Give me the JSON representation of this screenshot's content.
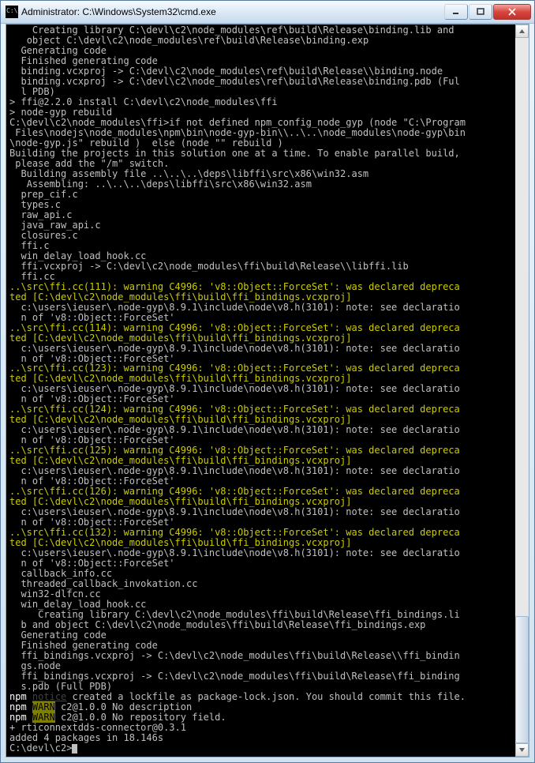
{
  "window": {
    "title": "Administrator: C:\\Windows\\System32\\cmd.exe"
  },
  "terminal": {
    "lines": [
      {
        "cls": "",
        "txt": "    Creating library C:\\devl\\c2\\node_modules\\ref\\build\\Release\\binding.lib and"
      },
      {
        "cls": "",
        "txt": "   object C:\\devl\\c2\\node_modules\\ref\\build\\Release\\binding.exp"
      },
      {
        "cls": "",
        "txt": "  Generating code"
      },
      {
        "cls": "",
        "txt": "  Finished generating code"
      },
      {
        "cls": "",
        "txt": "  binding.vcxproj -> C:\\devl\\c2\\node_modules\\ref\\build\\Release\\\\binding.node"
      },
      {
        "cls": "",
        "txt": "  binding.vcxproj -> C:\\devl\\c2\\node_modules\\ref\\build\\Release\\binding.pdb (Ful"
      },
      {
        "cls": "",
        "txt": "  l PDB)"
      },
      {
        "cls": "",
        "txt": ""
      },
      {
        "cls": "",
        "txt": "> ffi@2.2.0 install C:\\devl\\c2\\node_modules\\ffi"
      },
      {
        "cls": "",
        "txt": "> node-gyp rebuild"
      },
      {
        "cls": "",
        "txt": ""
      },
      {
        "cls": "",
        "txt": ""
      },
      {
        "cls": "",
        "txt": "C:\\devl\\c2\\node_modules\\ffi>if not defined npm_config_node_gyp (node \"C:\\Program"
      },
      {
        "cls": "",
        "txt": " Files\\nodejs\\node_modules\\npm\\bin\\node-gyp-bin\\\\..\\..\\node_modules\\node-gyp\\bin"
      },
      {
        "cls": "",
        "txt": "\\node-gyp.js\" rebuild )  else (node \"\" rebuild )"
      },
      {
        "cls": "",
        "txt": "Building the projects in this solution one at a time. To enable parallel build,"
      },
      {
        "cls": "",
        "txt": " please add the \"/m\" switch."
      },
      {
        "cls": "",
        "txt": "  Building assembly file ..\\..\\..\\deps\\libffi\\src\\x86\\win32.asm"
      },
      {
        "cls": "",
        "txt": "   Assembling: ..\\..\\..\\deps\\libffi\\src\\x86\\win32.asm"
      },
      {
        "cls": "",
        "txt": "  prep_cif.c"
      },
      {
        "cls": "",
        "txt": "  types.c"
      },
      {
        "cls": "",
        "txt": "  raw_api.c"
      },
      {
        "cls": "",
        "txt": "  java_raw_api.c"
      },
      {
        "cls": "",
        "txt": "  closures.c"
      },
      {
        "cls": "",
        "txt": "  ffi.c"
      },
      {
        "cls": "",
        "txt": "  win_delay_load_hook.cc"
      },
      {
        "cls": "",
        "txt": "  ffi.vcxproj -> C:\\devl\\c2\\node_modules\\ffi\\build\\Release\\\\libffi.lib"
      },
      {
        "cls": "",
        "txt": "  ffi.cc"
      },
      {
        "cls": "y",
        "txt": "..\\src\\ffi.cc(111): warning C4996: 'v8::Object::ForceSet': was declared depreca"
      },
      {
        "cls": "y",
        "txt": "ted [C:\\devl\\c2\\node_modules\\ffi\\build\\ffi_bindings.vcxproj]"
      },
      {
        "cls": "",
        "txt": "  c:\\users\\ieuser\\.node-gyp\\8.9.1\\include\\node\\v8.h(3101): note: see declaratio"
      },
      {
        "cls": "",
        "txt": "  n of 'v8::Object::ForceSet'"
      },
      {
        "cls": "y",
        "txt": "..\\src\\ffi.cc(114): warning C4996: 'v8::Object::ForceSet': was declared depreca"
      },
      {
        "cls": "y",
        "txt": "ted [C:\\devl\\c2\\node_modules\\ffi\\build\\ffi_bindings.vcxproj]"
      },
      {
        "cls": "",
        "txt": "  c:\\users\\ieuser\\.node-gyp\\8.9.1\\include\\node\\v8.h(3101): note: see declaratio"
      },
      {
        "cls": "",
        "txt": "  n of 'v8::Object::ForceSet'"
      },
      {
        "cls": "y",
        "txt": "..\\src\\ffi.cc(123): warning C4996: 'v8::Object::ForceSet': was declared depreca"
      },
      {
        "cls": "y",
        "txt": "ted [C:\\devl\\c2\\node_modules\\ffi\\build\\ffi_bindings.vcxproj]"
      },
      {
        "cls": "",
        "txt": "  c:\\users\\ieuser\\.node-gyp\\8.9.1\\include\\node\\v8.h(3101): note: see declaratio"
      },
      {
        "cls": "",
        "txt": "  n of 'v8::Object::ForceSet'"
      },
      {
        "cls": "y",
        "txt": "..\\src\\ffi.cc(124): warning C4996: 'v8::Object::ForceSet': was declared depreca"
      },
      {
        "cls": "y",
        "txt": "ted [C:\\devl\\c2\\node_modules\\ffi\\build\\ffi_bindings.vcxproj]"
      },
      {
        "cls": "",
        "txt": "  c:\\users\\ieuser\\.node-gyp\\8.9.1\\include\\node\\v8.h(3101): note: see declaratio"
      },
      {
        "cls": "",
        "txt": "  n of 'v8::Object::ForceSet'"
      },
      {
        "cls": "y",
        "txt": "..\\src\\ffi.cc(125): warning C4996: 'v8::Object::ForceSet': was declared depreca"
      },
      {
        "cls": "y",
        "txt": "ted [C:\\devl\\c2\\node_modules\\ffi\\build\\ffi_bindings.vcxproj]"
      },
      {
        "cls": "",
        "txt": "  c:\\users\\ieuser\\.node-gyp\\8.9.1\\include\\node\\v8.h(3101): note: see declaratio"
      },
      {
        "cls": "",
        "txt": "  n of 'v8::Object::ForceSet'"
      },
      {
        "cls": "y",
        "txt": "..\\src\\ffi.cc(126): warning C4996: 'v8::Object::ForceSet': was declared depreca"
      },
      {
        "cls": "y",
        "txt": "ted [C:\\devl\\c2\\node_modules\\ffi\\build\\ffi_bindings.vcxproj]"
      },
      {
        "cls": "",
        "txt": "  c:\\users\\ieuser\\.node-gyp\\8.9.1\\include\\node\\v8.h(3101): note: see declaratio"
      },
      {
        "cls": "",
        "txt": "  n of 'v8::Object::ForceSet'"
      },
      {
        "cls": "y",
        "txt": "..\\src\\ffi.cc(132): warning C4996: 'v8::Object::ForceSet': was declared depreca"
      },
      {
        "cls": "y",
        "txt": "ted [C:\\devl\\c2\\node_modules\\ffi\\build\\ffi_bindings.vcxproj]"
      },
      {
        "cls": "",
        "txt": "  c:\\users\\ieuser\\.node-gyp\\8.9.1\\include\\node\\v8.h(3101): note: see declaratio"
      },
      {
        "cls": "",
        "txt": "  n of 'v8::Object::ForceSet'"
      },
      {
        "cls": "",
        "txt": "  callback_info.cc"
      },
      {
        "cls": "",
        "txt": "  threaded_callback_invokation.cc"
      },
      {
        "cls": "",
        "txt": "  win32-dlfcn.cc"
      },
      {
        "cls": "",
        "txt": "  win_delay_load_hook.cc"
      },
      {
        "cls": "",
        "txt": "     Creating library C:\\devl\\c2\\node_modules\\ffi\\build\\Release\\ffi_bindings.li"
      },
      {
        "cls": "",
        "txt": "  b and object C:\\devl\\c2\\node_modules\\ffi\\build\\Release\\ffi_bindings.exp"
      },
      {
        "cls": "",
        "txt": "  Generating code"
      },
      {
        "cls": "",
        "txt": "  Finished generating code"
      },
      {
        "cls": "",
        "txt": "  ffi_bindings.vcxproj -> C:\\devl\\c2\\node_modules\\ffi\\build\\Release\\\\ffi_bindin"
      },
      {
        "cls": "",
        "txt": "  gs.node"
      },
      {
        "cls": "",
        "txt": "  ffi_bindings.vcxproj -> C:\\devl\\c2\\node_modules\\ffi\\build\\Release\\ffi_binding"
      },
      {
        "cls": "",
        "txt": "  s.pdb (Full PDB)"
      }
    ],
    "npm_notice_prefix": "npm",
    "npm_notice_tag": "notice",
    "npm_notice_text": " created a lockfile as package-lock.json. You should commit this file.",
    "npm_warn_prefix": "npm",
    "npm_warn_tag": "WARN",
    "npm_warn1": " c2@1.0.0 No description",
    "npm_warn2": " c2@1.0.0 No repository field.",
    "footer1": "+ rticonnextdds-connector@0.3.1",
    "footer2": "added 4 packages in 18.146s",
    "prompt": "C:\\devl\\c2>"
  }
}
